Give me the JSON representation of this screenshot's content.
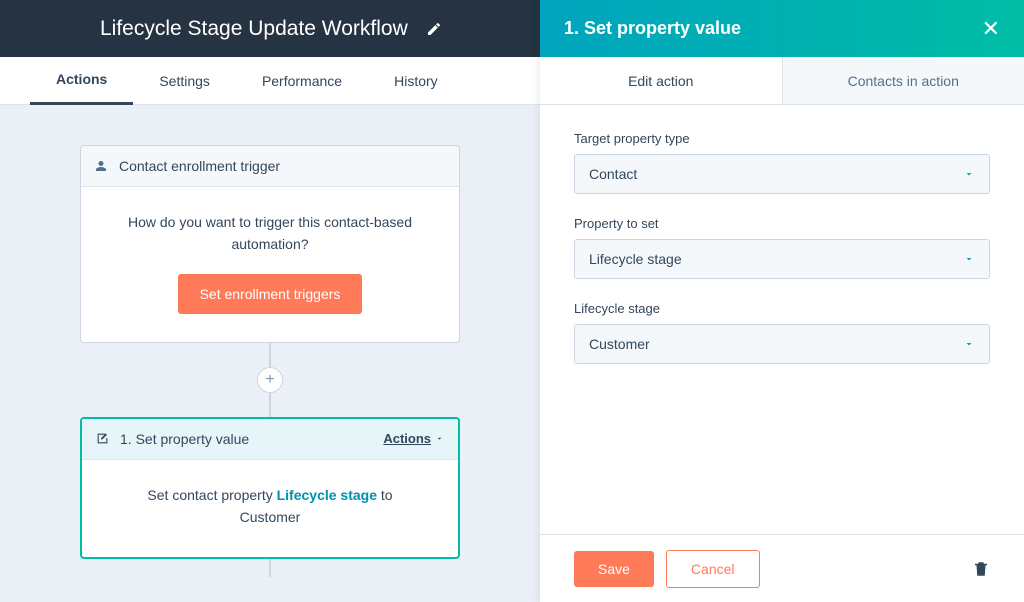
{
  "header": {
    "title": "Lifecycle Stage Update Workflow"
  },
  "tabs": [
    {
      "label": "Actions",
      "active": true
    },
    {
      "label": "Settings",
      "active": false
    },
    {
      "label": "Performance",
      "active": false
    },
    {
      "label": "History",
      "active": false
    }
  ],
  "trigger_card": {
    "title": "Contact enrollment trigger",
    "question": "How do you want to trigger this contact-based automation?",
    "button": "Set enrollment triggers"
  },
  "action_card": {
    "title": "1. Set property value",
    "actions_label": "Actions",
    "body_prefix": "Set contact property ",
    "body_link": "Lifecycle stage",
    "body_mid": " to ",
    "body_value": "Customer"
  },
  "panel": {
    "title": "1. Set property value",
    "tabs": {
      "edit": "Edit action",
      "contacts": "Contacts in action"
    },
    "fields": {
      "target_type": {
        "label": "Target property type",
        "value": "Contact"
      },
      "property": {
        "label": "Property to set",
        "value": "Lifecycle stage"
      },
      "stage": {
        "label": "Lifecycle stage",
        "value": "Customer"
      }
    },
    "save": "Save",
    "cancel": "Cancel"
  }
}
